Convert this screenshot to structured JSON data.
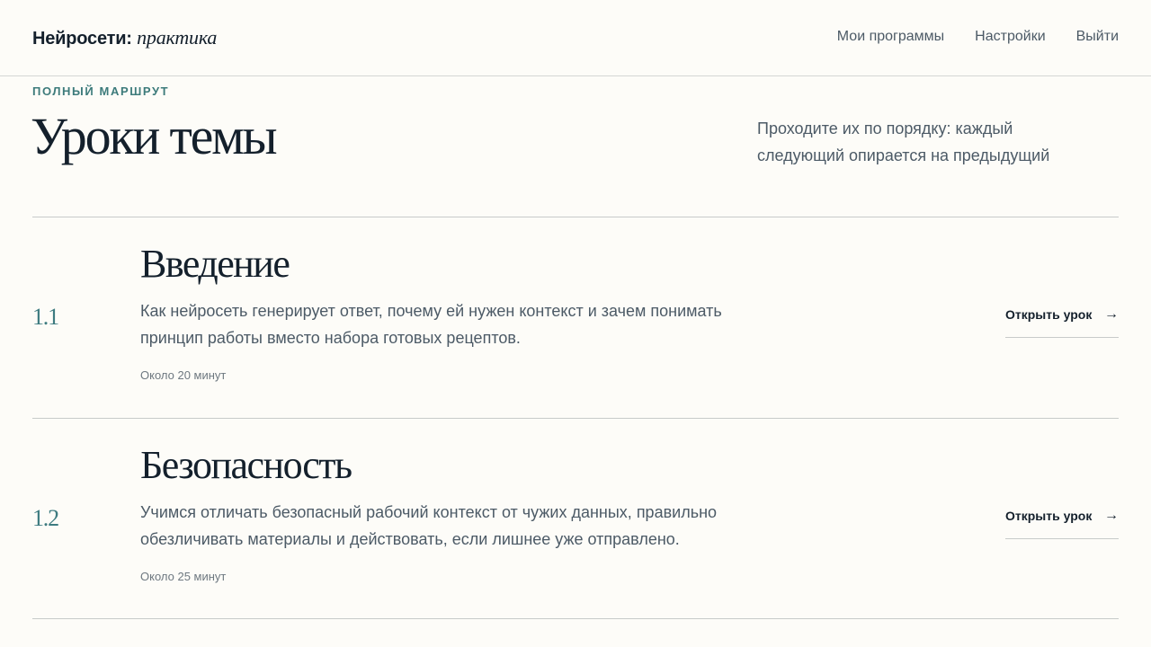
{
  "header": {
    "logo_main": "Нейросети:",
    "logo_italic": "практика",
    "nav": [
      {
        "label": "Мои программы"
      },
      {
        "label": "Настройки"
      },
      {
        "label": "Выйти"
      }
    ]
  },
  "intro": {
    "eyebrow": "ПОЛНЫЙ МАРШРУТ",
    "title": "Уроки темы",
    "subtitle": "Проходите их по порядку: каждый следующий опирается на предыдущий"
  },
  "lessons": [
    {
      "number": "1.1",
      "title": "Введение",
      "description": "Как нейросеть генерирует ответ, почему ей нужен контекст и зачем понимать принцип работы вместо набора готовых рецептов.",
      "duration": "Около 20 минут",
      "link_label": "Открыть урок",
      "link_icon": "→"
    },
    {
      "number": "1.2",
      "title": "Безопасность",
      "description": "Учимся отличать безопасный рабочий контекст от чужих данных, правильно обезличивать материалы и действовать, если лишнее уже отправлено.",
      "duration": "Около 25 минут",
      "link_label": "Открыть урок",
      "link_icon": "→"
    }
  ]
}
